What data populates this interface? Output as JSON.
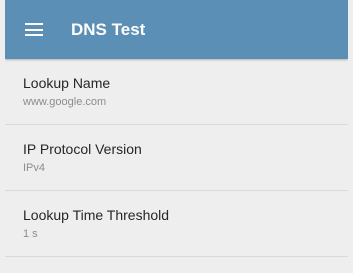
{
  "app_bar": {
    "title": "DNS Test",
    "menu_icon": "hamburger-menu-icon",
    "color": "#5b8fb6"
  },
  "settings": [
    {
      "label": "Lookup Name",
      "value": "www.google.com"
    },
    {
      "label": "IP Protocol Version",
      "value": "IPv4"
    },
    {
      "label": "Lookup Time Threshold",
      "value": "1 s"
    }
  ]
}
